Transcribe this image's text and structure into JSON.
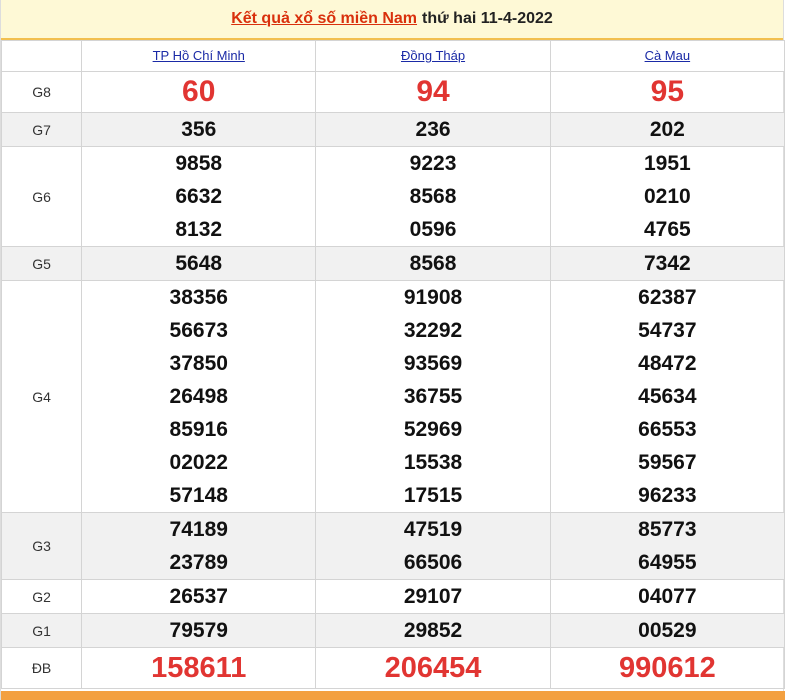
{
  "header": {
    "title_link": "Kết quả xổ số miền Nam",
    "title_rest": "thứ hai 11-4-2022"
  },
  "provinces": [
    "TP Hồ Chí Minh",
    "Đồng Tháp",
    "Cà Mau"
  ],
  "prizes": [
    {
      "label": "G8",
      "style": "big-red",
      "alt": false,
      "values": [
        [
          "60"
        ],
        [
          "94"
        ],
        [
          "95"
        ]
      ]
    },
    {
      "label": "G7",
      "style": "normal",
      "alt": true,
      "values": [
        [
          "356"
        ],
        [
          "236"
        ],
        [
          "202"
        ]
      ]
    },
    {
      "label": "G6",
      "style": "normal",
      "alt": false,
      "values": [
        [
          "9858",
          "6632",
          "8132"
        ],
        [
          "9223",
          "8568",
          "0596"
        ],
        [
          "1951",
          "0210",
          "4765"
        ]
      ]
    },
    {
      "label": "G5",
      "style": "normal",
      "alt": true,
      "values": [
        [
          "5648"
        ],
        [
          "8568"
        ],
        [
          "7342"
        ]
      ]
    },
    {
      "label": "G4",
      "style": "normal",
      "alt": false,
      "values": [
        [
          "38356",
          "56673",
          "37850",
          "26498",
          "85916",
          "02022",
          "57148"
        ],
        [
          "91908",
          "32292",
          "93569",
          "36755",
          "52969",
          "15538",
          "17515"
        ],
        [
          "62387",
          "54737",
          "48472",
          "45634",
          "66553",
          "59567",
          "96233"
        ]
      ]
    },
    {
      "label": "G3",
      "style": "normal",
      "alt": true,
      "values": [
        [
          "74189",
          "23789"
        ],
        [
          "47519",
          "66506"
        ],
        [
          "85773",
          "64955"
        ]
      ]
    },
    {
      "label": "G2",
      "style": "normal",
      "alt": false,
      "values": [
        [
          "26537"
        ],
        [
          "29107"
        ],
        [
          "04077"
        ]
      ]
    },
    {
      "label": "G1",
      "style": "normal",
      "alt": true,
      "values": [
        [
          "79579"
        ],
        [
          "29852"
        ],
        [
          "00529"
        ]
      ]
    },
    {
      "label": "ĐB",
      "style": "db-red",
      "alt": false,
      "values": [
        [
          "158611"
        ],
        [
          "206454"
        ],
        [
          "990612"
        ]
      ]
    }
  ],
  "colors": {
    "accent_red": "#e13532",
    "title_red": "#d9300c",
    "link_blue": "#1a2aa6",
    "title_bg": "#fef9d6",
    "bottom_bar": "#f3a040"
  }
}
